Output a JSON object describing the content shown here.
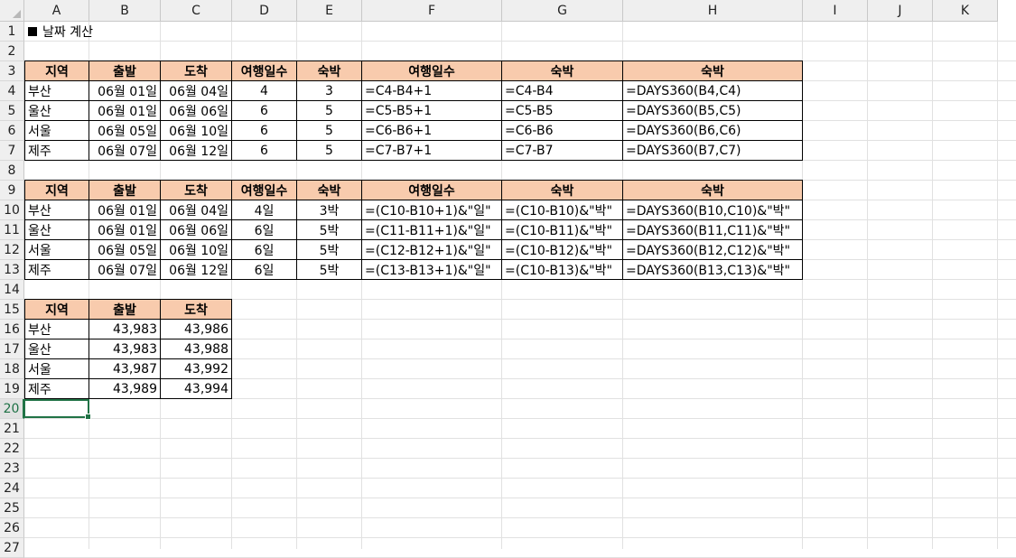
{
  "columns": [
    "A",
    "B",
    "C",
    "D",
    "E",
    "F",
    "G",
    "H",
    "I",
    "J",
    "K"
  ],
  "rows": [
    "1",
    "2",
    "3",
    "4",
    "5",
    "6",
    "7",
    "8",
    "9",
    "10",
    "11",
    "12",
    "13",
    "14",
    "15",
    "16",
    "17",
    "18",
    "19",
    "20",
    "21",
    "22",
    "23",
    "24",
    "25",
    "26",
    "27"
  ],
  "selected_row": "20",
  "title": "날짜 계산",
  "table1": {
    "headers": [
      "지역",
      "출발",
      "도착",
      "여행일수",
      "숙박",
      "여행일수",
      "숙박",
      "숙박"
    ],
    "rows": [
      [
        "부산",
        "06월 01일",
        "06월 04일",
        "4",
        "3",
        "=C4-B4+1",
        "=C4-B4",
        "=DAYS360(B4,C4)"
      ],
      [
        "울산",
        "06월 01일",
        "06월 06일",
        "6",
        "5",
        "=C5-B5+1",
        "=C5-B5",
        "=DAYS360(B5,C5)"
      ],
      [
        "서울",
        "06월 05일",
        "06월 10일",
        "6",
        "5",
        "=C6-B6+1",
        "=C6-B6",
        "=DAYS360(B6,C6)"
      ],
      [
        "제주",
        "06월 07일",
        "06월 12일",
        "6",
        "5",
        "=C7-B7+1",
        "=C7-B7",
        "=DAYS360(B7,C7)"
      ]
    ]
  },
  "table2": {
    "headers": [
      "지역",
      "출발",
      "도착",
      "여행일수",
      "숙박",
      "여행일수",
      "숙박",
      "숙박"
    ],
    "rows": [
      [
        "부산",
        "06월 01일",
        "06월 04일",
        "4일",
        "3박",
        "=(C10-B10+1)&\"일\"",
        "=(C10-B10)&\"박\"",
        "=DAYS360(B10,C10)&\"박\""
      ],
      [
        "울산",
        "06월 01일",
        "06월 06일",
        "6일",
        "5박",
        "=(C11-B11+1)&\"일\"",
        "=(C10-B11)&\"박\"",
        "=DAYS360(B11,C11)&\"박\""
      ],
      [
        "서울",
        "06월 05일",
        "06월 10일",
        "6일",
        "5박",
        "=(C12-B12+1)&\"일\"",
        "=(C10-B12)&\"박\"",
        "=DAYS360(B12,C12)&\"박\""
      ],
      [
        "제주",
        "06월 07일",
        "06월 12일",
        "6일",
        "5박",
        "=(C13-B13+1)&\"일\"",
        "=(C10-B13)&\"박\"",
        "=DAYS360(B13,C13)&\"박\""
      ]
    ]
  },
  "table3": {
    "headers": [
      "지역",
      "출발",
      "도착"
    ],
    "rows": [
      [
        "부산",
        "43,983",
        "43,986"
      ],
      [
        "울산",
        "43,983",
        "43,988"
      ],
      [
        "서울",
        "43,987",
        "43,992"
      ],
      [
        "제주",
        "43,989",
        "43,994"
      ]
    ]
  },
  "colors": {
    "header_fill": "#f8cbad",
    "selection_green": "#217346",
    "gridline": "#e1e1e1"
  }
}
